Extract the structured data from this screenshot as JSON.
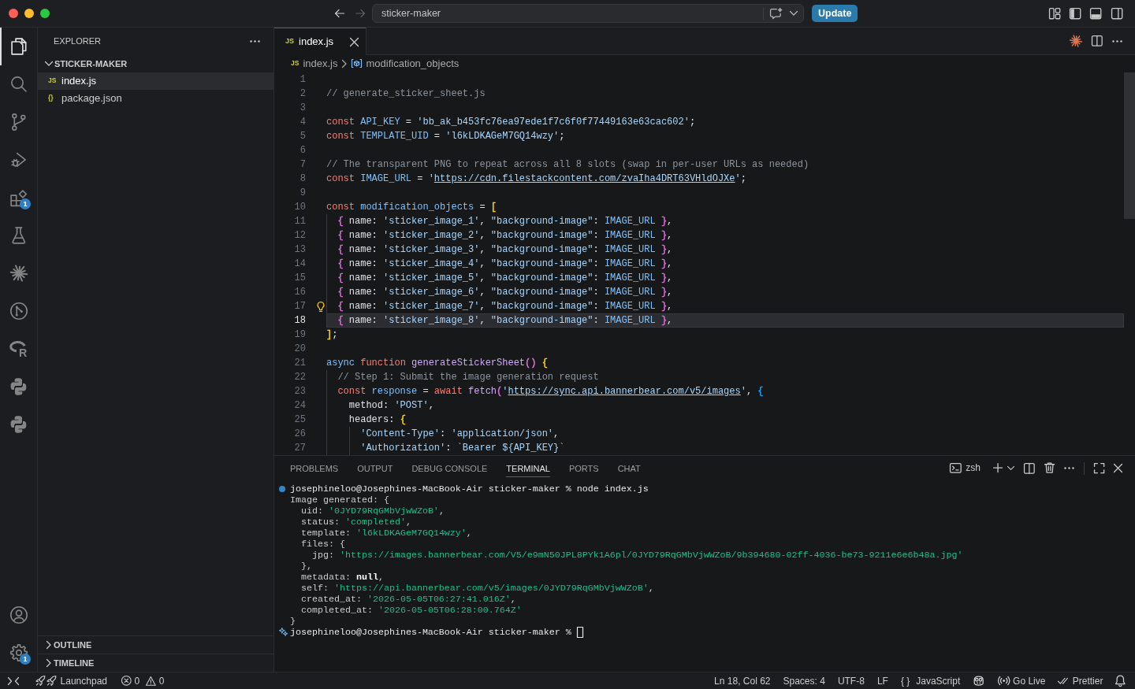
{
  "title_bar": {
    "nav": [
      {
        "kind": "back",
        "disabled": false
      },
      {
        "kind": "forward",
        "disabled": true
      }
    ],
    "command_center": {
      "label": "sticker-maker"
    },
    "update_button": "Update",
    "layout_toggles": [
      {
        "kind": "sidebar",
        "on": true
      },
      {
        "kind": "panel",
        "on": true
      },
      {
        "kind": "auxiliary",
        "on": false
      }
    ]
  },
  "activity_bar": {
    "items": [
      {
        "kind": "files",
        "selected": true
      },
      {
        "kind": "search",
        "selected": false
      },
      {
        "kind": "branch",
        "selected": false
      },
      {
        "kind": "debug",
        "selected": false
      },
      {
        "kind": "extensions",
        "selected": false,
        "badge": "1"
      },
      {
        "kind": "flask",
        "selected": false
      },
      {
        "kind": "starburst",
        "selected": false
      },
      {
        "kind": "graph",
        "selected": false
      },
      {
        "kind": "rlogo",
        "selected": false,
        "glyph": "R"
      },
      {
        "kind": "python",
        "selected": false
      },
      {
        "kind": "python",
        "selected": false
      }
    ],
    "bottom_items": [
      {
        "kind": "account",
        "selected": false
      },
      {
        "kind": "gear",
        "selected": false,
        "badge": "1"
      }
    ]
  },
  "sidebar": {
    "title": "EXPLORER",
    "folder": {
      "name": "STICKER-MAKER",
      "expanded": true,
      "files": [
        {
          "icon": "JS",
          "name": "index.js",
          "selected": true
        },
        {
          "icon": "{}",
          "name": "package.json",
          "selected": false
        }
      ]
    },
    "sections": [
      {
        "name": "OUTLINE",
        "expanded": false
      },
      {
        "name": "TIMELINE",
        "expanded": false
      }
    ]
  },
  "editor": {
    "tabs": [
      {
        "icon": "JS",
        "label": "index.js",
        "selected": true
      }
    ],
    "breadcrumb": [
      {
        "kind": "file",
        "icon": "JS",
        "label": "index.js"
      },
      {
        "kind": "symbol",
        "label": "modification_objects"
      }
    ],
    "lines": [
      {
        "number": "1",
        "current": false,
        "lightbulb": false
      },
      {
        "number": "2",
        "current": false,
        "lightbulb": false,
        "tokens": [
          {
            "kind": "comment",
            "text": "// generate_sticker_sheet.js"
          }
        ]
      },
      {
        "number": "3",
        "current": false,
        "lightbulb": false
      },
      {
        "number": "4",
        "current": false,
        "lightbulb": false,
        "tokens": [
          {
            "kind": "keyword",
            "text": "const "
          },
          {
            "kind": "constant",
            "text": "API_KEY"
          },
          {
            "kind": "plain",
            "text": " = "
          },
          {
            "kind": "string",
            "text": "'bb_ak_b453fc76ea97ede1f7c6f0f77449163e63cac602'"
          },
          {
            "kind": "plain",
            "text": ";"
          }
        ]
      },
      {
        "number": "5",
        "current": false,
        "lightbulb": false,
        "tokens": [
          {
            "kind": "keyword",
            "text": "const "
          },
          {
            "kind": "constant",
            "text": "TEMPLATE_UID"
          },
          {
            "kind": "plain",
            "text": " = "
          },
          {
            "kind": "string",
            "text": "'l6kLDKAGeM7GQ14wzy'"
          },
          {
            "kind": "plain",
            "text": ";"
          }
        ]
      },
      {
        "number": "6",
        "current": false,
        "lightbulb": false
      },
      {
        "number": "7",
        "current": false,
        "lightbulb": false,
        "tokens": [
          {
            "kind": "comment",
            "text": "// The transparent PNG to repeat across all 8 slots (swap in per-user URLs as needed)"
          }
        ]
      },
      {
        "number": "8",
        "current": false,
        "lightbulb": false,
        "tokens": [
          {
            "kind": "keyword",
            "text": "const "
          },
          {
            "kind": "constant",
            "text": "IMAGE_URL"
          },
          {
            "kind": "plain",
            "text": " = "
          },
          {
            "kind": "string",
            "text": "'"
          },
          {
            "kind": "link",
            "text": "https://cdn.filestackcontent.com/zvaIha4DRT63VHldOJXe"
          },
          {
            "kind": "string",
            "text": "'"
          },
          {
            "kind": "plain",
            "text": ";"
          }
        ]
      },
      {
        "number": "9",
        "current": false,
        "lightbulb": false
      },
      {
        "number": "10",
        "current": false,
        "lightbulb": false,
        "tokens": [
          {
            "kind": "keyword",
            "text": "const "
          },
          {
            "kind": "constant",
            "text": "modification_objects"
          },
          {
            "kind": "plain",
            "text": " = "
          },
          {
            "kind": "bracket",
            "text": "[",
            "color": "#ffd700"
          }
        ]
      },
      {
        "number": "11",
        "current": false,
        "lightbulb": false,
        "tokens": [
          {
            "kind": "bracket",
            "text": "  {",
            "color": "#da70d6"
          },
          {
            "kind": "plain",
            "text": " name: "
          },
          {
            "kind": "string",
            "text": "'sticker_image_1'"
          },
          {
            "kind": "plain",
            "text": ", "
          },
          {
            "kind": "string",
            "text": "\"background-image\""
          },
          {
            "kind": "plain",
            "text": ": "
          },
          {
            "kind": "constant",
            "text": "IMAGE_URL "
          },
          {
            "kind": "bracket",
            "text": "}",
            "color": "#da70d6"
          },
          {
            "kind": "plain",
            "text": ","
          }
        ]
      },
      {
        "number": "12",
        "current": false,
        "lightbulb": false,
        "tokens": [
          {
            "kind": "bracket",
            "text": "  {",
            "color": "#da70d6"
          },
          {
            "kind": "plain",
            "text": " name: "
          },
          {
            "kind": "string",
            "text": "'sticker_image_2'"
          },
          {
            "kind": "plain",
            "text": ", "
          },
          {
            "kind": "string",
            "text": "\"background-image\""
          },
          {
            "kind": "plain",
            "text": ": "
          },
          {
            "kind": "constant",
            "text": "IMAGE_URL "
          },
          {
            "kind": "bracket",
            "text": "}",
            "color": "#da70d6"
          },
          {
            "kind": "plain",
            "text": ","
          }
        ]
      },
      {
        "number": "13",
        "current": false,
        "lightbulb": false,
        "tokens": [
          {
            "kind": "bracket",
            "text": "  {",
            "color": "#da70d6"
          },
          {
            "kind": "plain",
            "text": " name: "
          },
          {
            "kind": "string",
            "text": "'sticker_image_3'"
          },
          {
            "kind": "plain",
            "text": ", "
          },
          {
            "kind": "string",
            "text": "\"background-image\""
          },
          {
            "kind": "plain",
            "text": ": "
          },
          {
            "kind": "constant",
            "text": "IMAGE_URL "
          },
          {
            "kind": "bracket",
            "text": "}",
            "color": "#da70d6"
          },
          {
            "kind": "plain",
            "text": ","
          }
        ]
      },
      {
        "number": "14",
        "current": false,
        "lightbulb": false,
        "tokens": [
          {
            "kind": "bracket",
            "text": "  {",
            "color": "#da70d6"
          },
          {
            "kind": "plain",
            "text": " name: "
          },
          {
            "kind": "string",
            "text": "'sticker_image_4'"
          },
          {
            "kind": "plain",
            "text": ", "
          },
          {
            "kind": "string",
            "text": "\"background-image\""
          },
          {
            "kind": "plain",
            "text": ": "
          },
          {
            "kind": "constant",
            "text": "IMAGE_URL "
          },
          {
            "kind": "bracket",
            "text": "}",
            "color": "#da70d6"
          },
          {
            "kind": "plain",
            "text": ","
          }
        ]
      },
      {
        "number": "15",
        "current": false,
        "lightbulb": false,
        "tokens": [
          {
            "kind": "bracket",
            "text": "  {",
            "color": "#da70d6"
          },
          {
            "kind": "plain",
            "text": " name: "
          },
          {
            "kind": "string",
            "text": "'sticker_image_5'"
          },
          {
            "kind": "plain",
            "text": ", "
          },
          {
            "kind": "string",
            "text": "\"background-image\""
          },
          {
            "kind": "plain",
            "text": ": "
          },
          {
            "kind": "constant",
            "text": "IMAGE_URL "
          },
          {
            "kind": "bracket",
            "text": "}",
            "color": "#da70d6"
          },
          {
            "kind": "plain",
            "text": ","
          }
        ]
      },
      {
        "number": "16",
        "current": false,
        "lightbulb": false,
        "tokens": [
          {
            "kind": "bracket",
            "text": "  {",
            "color": "#da70d6"
          },
          {
            "kind": "plain",
            "text": " name: "
          },
          {
            "kind": "string",
            "text": "'sticker_image_6'"
          },
          {
            "kind": "plain",
            "text": ", "
          },
          {
            "kind": "string",
            "text": "\"background-image\""
          },
          {
            "kind": "plain",
            "text": ": "
          },
          {
            "kind": "constant",
            "text": "IMAGE_URL "
          },
          {
            "kind": "bracket",
            "text": "}",
            "color": "#da70d6"
          },
          {
            "kind": "plain",
            "text": ","
          }
        ]
      },
      {
        "number": "17",
        "current": false,
        "lightbulb": true,
        "tokens": [
          {
            "kind": "bracket",
            "text": "  {",
            "color": "#da70d6"
          },
          {
            "kind": "plain",
            "text": " name: "
          },
          {
            "kind": "string",
            "text": "'sticker_image_7'"
          },
          {
            "kind": "plain",
            "text": ", "
          },
          {
            "kind": "string",
            "text": "\"background-image\""
          },
          {
            "kind": "plain",
            "text": ": "
          },
          {
            "kind": "constant",
            "text": "IMAGE_URL "
          },
          {
            "kind": "bracket",
            "text": "}",
            "color": "#da70d6"
          },
          {
            "kind": "plain",
            "text": ","
          }
        ]
      },
      {
        "number": "18",
        "current": true,
        "lightbulb": false,
        "tokens": [
          {
            "kind": "bracket",
            "text": "  {",
            "color": "#da70d6"
          },
          {
            "kind": "plain",
            "text": " name: "
          },
          {
            "kind": "string",
            "text": "'sticker_image_8'"
          },
          {
            "kind": "plain",
            "text": ", "
          },
          {
            "kind": "string",
            "text": "\"background-image\""
          },
          {
            "kind": "plain",
            "text": ": "
          },
          {
            "kind": "constant",
            "text": "IMAGE_URL "
          },
          {
            "kind": "bracket",
            "text": "}",
            "color": "#da70d6"
          },
          {
            "kind": "plain",
            "text": ","
          }
        ]
      },
      {
        "number": "19",
        "current": false,
        "lightbulb": false,
        "tokens": [
          {
            "kind": "bracket",
            "text": "]",
            "color": "#ffd700"
          },
          {
            "kind": "plain",
            "text": ";"
          }
        ]
      },
      {
        "number": "20",
        "current": false,
        "lightbulb": false
      },
      {
        "number": "21",
        "current": false,
        "lightbulb": false,
        "tokens": [
          {
            "kind": "storage",
            "text": "async "
          },
          {
            "kind": "keyword",
            "text": "function "
          },
          {
            "kind": "function",
            "text": "generateStickerSheet"
          },
          {
            "kind": "bracket",
            "text": "()",
            "color": "#da70d6"
          },
          {
            "kind": "bracket",
            "text": " {",
            "color": "#ffd700"
          }
        ]
      },
      {
        "number": "22",
        "current": false,
        "lightbulb": false,
        "tokens": [
          {
            "kind": "comment",
            "text": "  // Step 1: Submit the image generation request"
          }
        ]
      },
      {
        "number": "23",
        "current": false,
        "lightbulb": false,
        "tokens": [
          {
            "kind": "keyword",
            "text": "  const "
          },
          {
            "kind": "constant",
            "text": "response"
          },
          {
            "kind": "plain",
            "text": " = "
          },
          {
            "kind": "keyword",
            "text": "await "
          },
          {
            "kind": "function",
            "text": "fetch"
          },
          {
            "kind": "bracket",
            "text": "(",
            "color": "#da70d6"
          },
          {
            "kind": "string",
            "text": "'"
          },
          {
            "kind": "link",
            "text": "https://sync.api.bannerbear.com/v5/images"
          },
          {
            "kind": "string",
            "text": "'"
          },
          {
            "kind": "plain",
            "text": ", "
          },
          {
            "kind": "bracket",
            "text": "{",
            "color": "#179fff"
          }
        ]
      },
      {
        "number": "24",
        "current": false,
        "lightbulb": false,
        "tokens": [
          {
            "kind": "plain",
            "text": "    method: "
          },
          {
            "kind": "string",
            "text": "'POST'"
          },
          {
            "kind": "plain",
            "text": ","
          }
        ]
      },
      {
        "number": "25",
        "current": false,
        "lightbulb": false,
        "tokens": [
          {
            "kind": "plain",
            "text": "    headers: "
          },
          {
            "kind": "bracket",
            "text": "{",
            "color": "#ffd700"
          }
        ]
      },
      {
        "number": "26",
        "current": false,
        "lightbulb": false,
        "tokens": [
          {
            "kind": "string",
            "text": "      'Content-Type'"
          },
          {
            "kind": "plain",
            "text": ": "
          },
          {
            "kind": "string",
            "text": "'application/json'"
          },
          {
            "kind": "plain",
            "text": ","
          }
        ]
      },
      {
        "number": "27",
        "current": false,
        "lightbulb": false,
        "tokens": [
          {
            "kind": "string",
            "text": "      'Authorization'"
          },
          {
            "kind": "plain",
            "text": ": "
          },
          {
            "kind": "string",
            "text": "`Bearer ${API_KEY}`"
          }
        ]
      }
    ]
  },
  "panel": {
    "tabs": [
      {
        "label": "PROBLEMS",
        "selected": false
      },
      {
        "label": "OUTPUT",
        "selected": false
      },
      {
        "label": "DEBUG CONSOLE",
        "selected": false
      },
      {
        "label": "TERMINAL",
        "selected": true
      },
      {
        "label": "PORTS",
        "selected": false
      },
      {
        "label": "CHAT",
        "selected": false
      }
    ],
    "terminal_name": "zsh",
    "terminal_lines": [
      {
        "kind": "command",
        "tokens": [
          {
            "kind": "plain",
            "text": "josephineloo@Josephines-MacBook-Air sticker-maker % node index.js"
          }
        ]
      },
      {
        "kind": "output",
        "tokens": [
          {
            "kind": "plain",
            "text": "Image generated: {"
          }
        ]
      },
      {
        "kind": "output",
        "tokens": [
          {
            "kind": "plain",
            "text": "  uid: "
          },
          {
            "kind": "string",
            "text": "'0JYD79RqGMbVjwWZoB'"
          },
          {
            "kind": "plain",
            "text": ","
          }
        ]
      },
      {
        "kind": "output",
        "tokens": [
          {
            "kind": "plain",
            "text": "  status: "
          },
          {
            "kind": "string",
            "text": "'completed'"
          },
          {
            "kind": "plain",
            "text": ","
          }
        ]
      },
      {
        "kind": "output",
        "tokens": [
          {
            "kind": "plain",
            "text": "  template: "
          },
          {
            "kind": "string",
            "text": "'l6kLDKAGeM7GQ14wzy'"
          },
          {
            "kind": "plain",
            "text": ","
          }
        ]
      },
      {
        "kind": "output",
        "tokens": [
          {
            "kind": "plain",
            "text": "  files: {"
          }
        ]
      },
      {
        "kind": "output",
        "tokens": [
          {
            "kind": "plain",
            "text": "    jpg: "
          },
          {
            "kind": "string",
            "text": "'https://images.bannerbear.com/V5/e9mN50JPL8PYk1A6pl/0JYD79RqGMbVjwWZoB/9b394680-02ff-4036-be73-9211e6e6b48a.jpg'"
          }
        ]
      },
      {
        "kind": "output",
        "tokens": [
          {
            "kind": "plain",
            "text": "  },"
          }
        ]
      },
      {
        "kind": "output",
        "tokens": [
          {
            "kind": "plain",
            "text": "  metadata: "
          },
          {
            "kind": "bold",
            "text": "null"
          },
          {
            "kind": "plain",
            "text": ","
          }
        ]
      },
      {
        "kind": "output",
        "tokens": [
          {
            "kind": "plain",
            "text": "  self: "
          },
          {
            "kind": "string",
            "text": "'https://api.bannerbear.com/v5/images/0JYD79RqGMbVjwWZoB'"
          },
          {
            "kind": "plain",
            "text": ","
          }
        ]
      },
      {
        "kind": "output",
        "tokens": [
          {
            "kind": "plain",
            "text": "  created_at: "
          },
          {
            "kind": "string",
            "text": "'2026-05-05T06:27:41.016Z'"
          },
          {
            "kind": "plain",
            "text": ","
          }
        ]
      },
      {
        "kind": "output",
        "tokens": [
          {
            "kind": "plain",
            "text": "  completed_at: "
          },
          {
            "kind": "string",
            "text": "'2026-05-05T06:28:00.764Z'"
          }
        ]
      },
      {
        "kind": "output",
        "tokens": [
          {
            "kind": "plain",
            "text": "}"
          }
        ]
      },
      {
        "kind": "prompt",
        "tokens": [
          {
            "kind": "plain",
            "text": "josephineloo@Josephines-MacBook-Air sticker-maker %"
          }
        ]
      }
    ]
  },
  "status_bar": {
    "left": [
      {
        "kind": "remote"
      },
      {
        "kind": "launchpad",
        "label": "Launchpad"
      },
      {
        "kind": "problems",
        "errors": "0",
        "warnings": "0"
      }
    ],
    "right": [
      {
        "kind": "text",
        "label": "Ln 18, Col 62"
      },
      {
        "kind": "text",
        "label": "Spaces: 4"
      },
      {
        "kind": "text",
        "label": "UTF-8"
      },
      {
        "kind": "text",
        "label": "LF"
      },
      {
        "kind": "language",
        "glyph": "{ }",
        "label": "JavaScript"
      },
      {
        "kind": "copilot"
      },
      {
        "kind": "golive",
        "label": "Go Live"
      },
      {
        "kind": "prettier",
        "label": "Prettier"
      },
      {
        "kind": "bell"
      }
    ]
  }
}
